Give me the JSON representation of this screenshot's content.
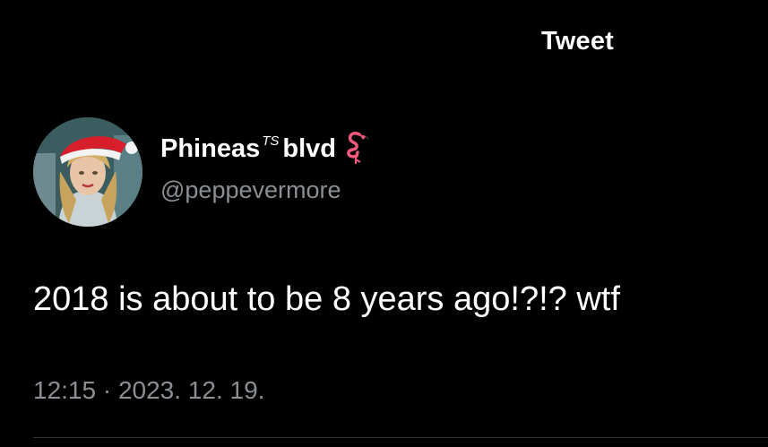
{
  "header": {
    "title": "Tweet"
  },
  "author": {
    "display_name_prefix": "Phineas",
    "display_name_superscript": "TS",
    "display_name_suffix": "blvd",
    "emoji": "flamingo-icon",
    "handle": "@peppevermore"
  },
  "tweet": {
    "text": "2018 is about to be 8 years ago!?!? wtf",
    "timestamp": "12:15 · 2023. 12. 19."
  },
  "colors": {
    "background": "#000000",
    "primary_text": "#ffffff",
    "secondary_text": "#8b8f93",
    "divider": "#2f3336",
    "flamingo": "#f25a7d"
  }
}
